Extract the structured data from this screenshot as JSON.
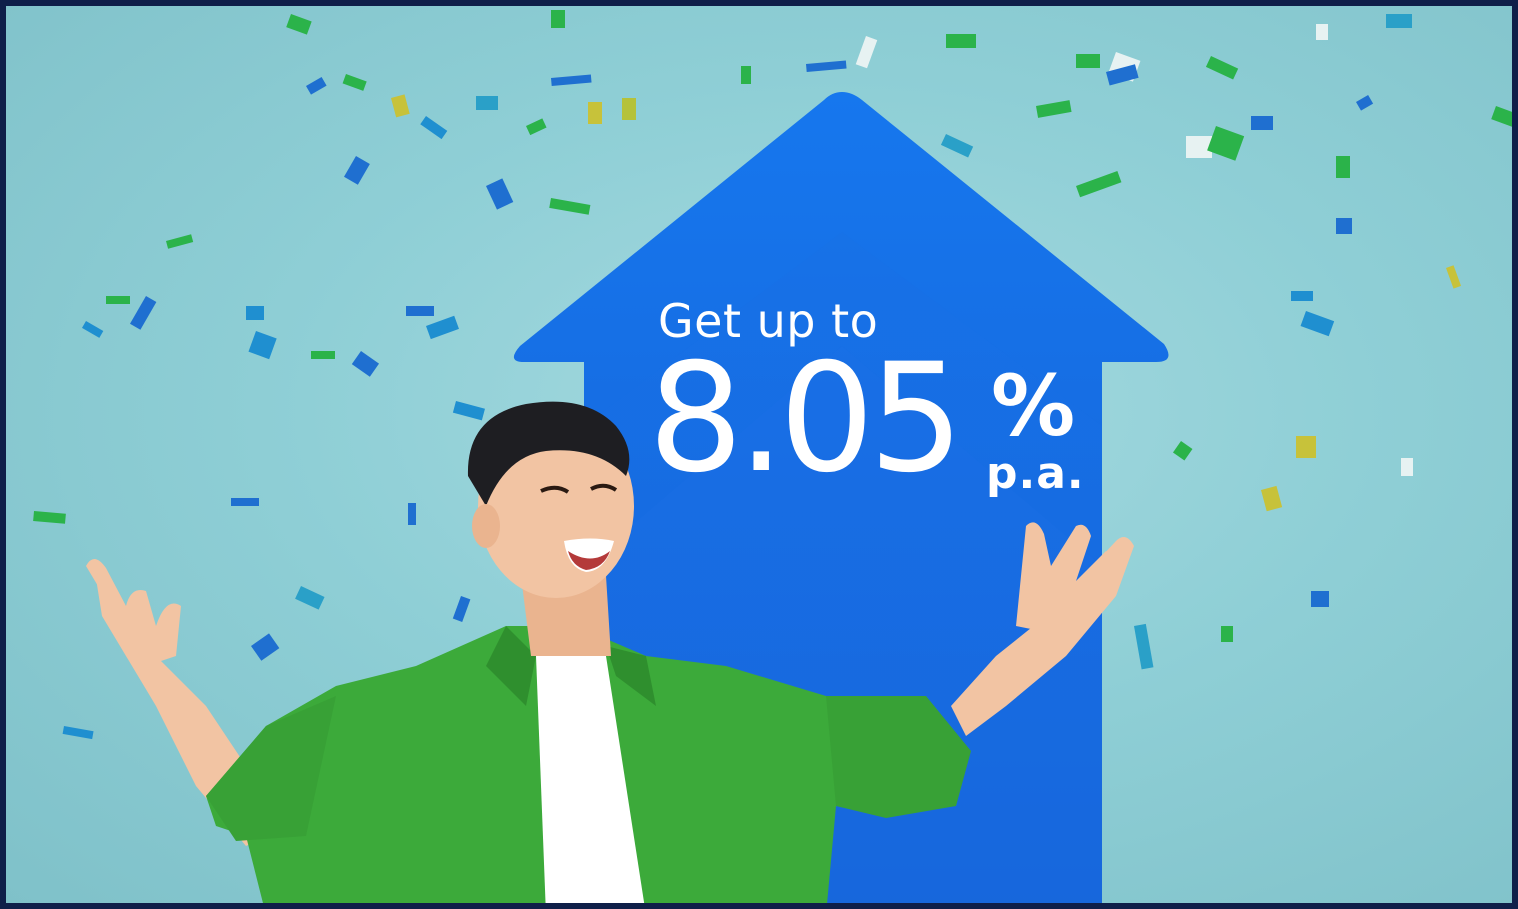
{
  "banner": {
    "intro": "Get up to",
    "rate_value": "8.05",
    "rate_symbol": "%",
    "rate_period": "p.a."
  },
  "colors": {
    "background": "#8fcfd6",
    "arrow": "#1670e6",
    "shirt": "#3caa3a",
    "text": "#ffffff",
    "frame": "#0f1f49"
  },
  "illustration": {
    "subject": "smiling-man-celebrating-icon",
    "decoration": "confetti-icon",
    "arrow": "up-arrow-icon"
  }
}
